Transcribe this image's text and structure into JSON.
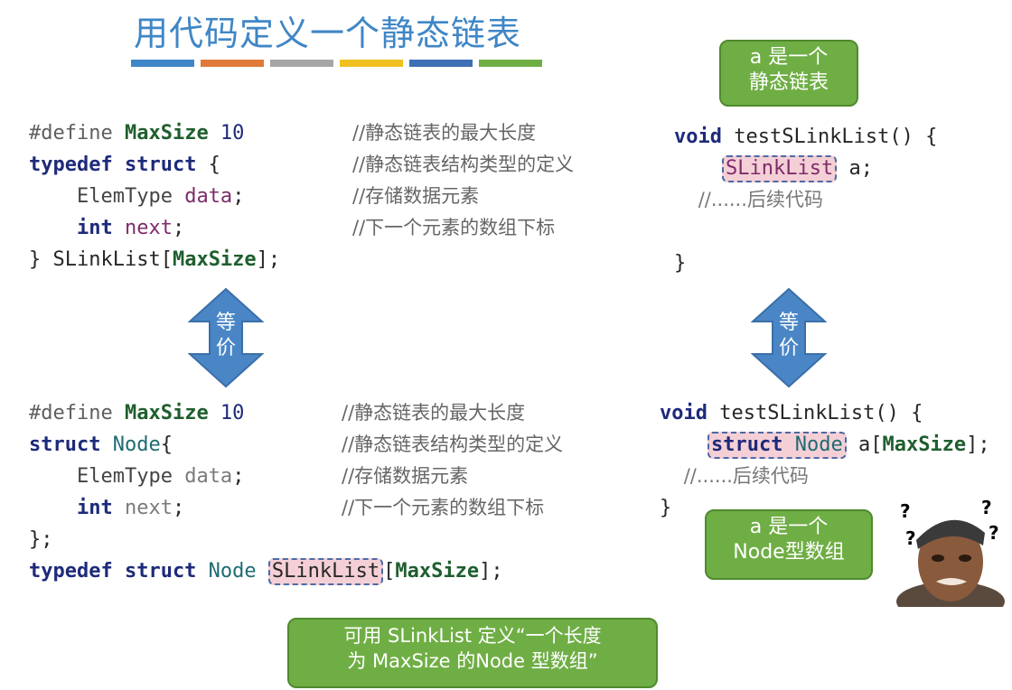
{
  "title": "用代码定义一个静态链表",
  "stripes": [
    "#3f86c6",
    "#e07a3a",
    "#a6a6a6",
    "#f0c020",
    "#3f6fb5",
    "#6fae45"
  ],
  "top_left": {
    "l1_pre": "#define ",
    "l1_name": "MaxSize",
    "l1_num": " 10",
    "l2_kw1": "typedef",
    "l2_kw2": " struct",
    "l2_rest": " {",
    "l3_type": "    ElemType",
    "l3_var": " data",
    "l3_end": ";",
    "l4_kw": "    int",
    "l4_var": " next",
    "l4_end": ";",
    "l5_a": "} SLinkList[",
    "l5_name": "MaxSize",
    "l5_b": "];",
    "c1": "//静态链表的最大长度",
    "c2": "//静态链表结构类型的定义",
    "c3": "//存储数据元素",
    "c4": "//下一个元素的数组下标"
  },
  "bottom_left": {
    "l1_pre": "#define ",
    "l1_name": "MaxSize",
    "l1_num": " 10",
    "l2_kw": "struct",
    "l2_name": " Node",
    "l2_end": "{",
    "l3_type": "    ElemType",
    "l3_var": " data",
    "l3_end": ";",
    "l4_kw": "    int",
    "l4_var": " next",
    "l4_end": ";",
    "l5": "};",
    "l6_kw": "typedef struct",
    "l6_name": " Node ",
    "l6_hl": "SLinkList",
    "l6_a": "[",
    "l6_max": "MaxSize",
    "l6_b": "];",
    "c1": "//静态链表的最大长度",
    "c2": "//静态链表结构类型的定义",
    "c3": "//存储数据元素",
    "c4": "//下一个元素的数组下标"
  },
  "top_right": {
    "l1_kw": "void",
    "l1_rest": " testSLinkList() {",
    "l2_hl": "SLinkList",
    "l2_rest": " a;",
    "l3": "//......后续代码",
    "l4": "}"
  },
  "bottom_right": {
    "l1_kw": "void",
    "l1_rest": " testSLinkList() {",
    "l2_kw": "struct",
    "l2_name": " Node",
    "l2_a": " a[",
    "l2_max": "MaxSize",
    "l2_b": "];",
    "l3": "//......后续代码",
    "l4": "}"
  },
  "arrow_label_1": "等",
  "arrow_label_2": "价",
  "bubble_top_right": {
    "line1": "a 是一个",
    "line2": "静态链表"
  },
  "bubble_bottom_right": {
    "line1": "a 是一个",
    "line2": "Node型数组"
  },
  "bubble_bottom": {
    "line1": "可用 SLinkList 定义“一个长度",
    "line2": "为 MaxSize 的Node 型数组”"
  },
  "question_mark": "?"
}
